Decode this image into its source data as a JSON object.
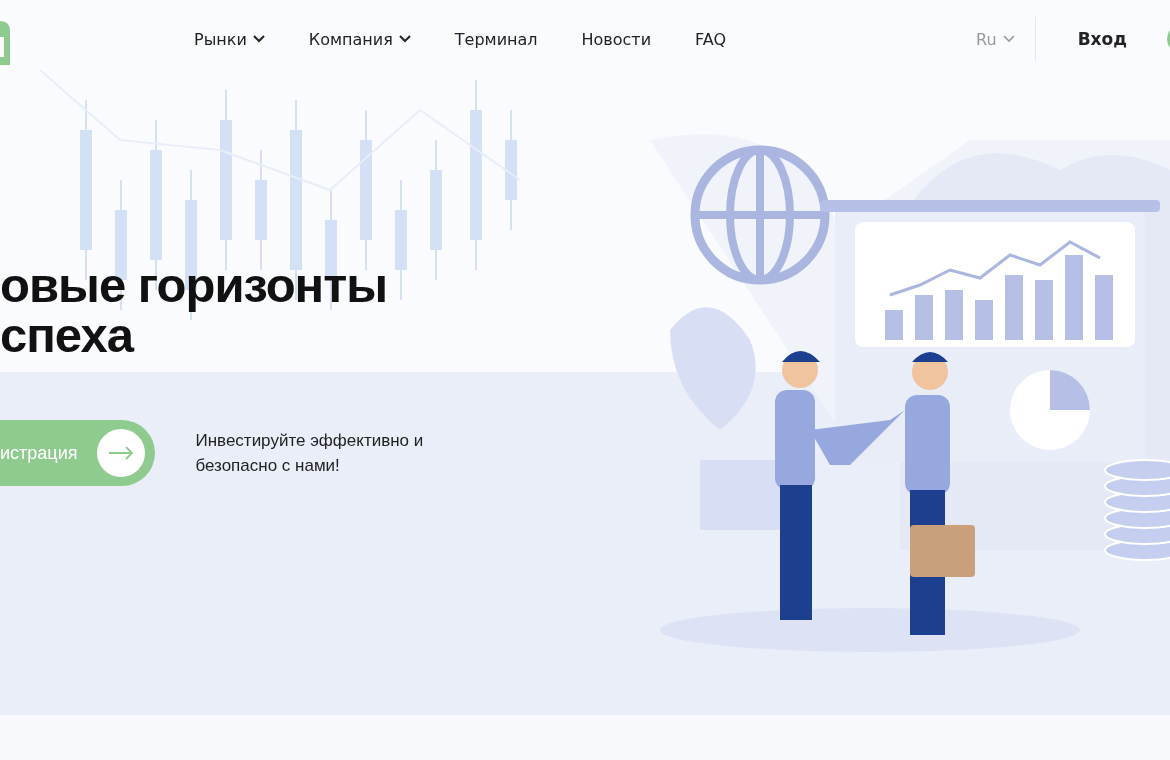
{
  "nav": {
    "items": [
      {
        "label": "Рынки",
        "has_dropdown": true
      },
      {
        "label": "Компания",
        "has_dropdown": true
      },
      {
        "label": "Терминал",
        "has_dropdown": false
      },
      {
        "label": "Новости",
        "has_dropdown": false
      },
      {
        "label": "FAQ",
        "has_dropdown": false
      }
    ],
    "language": "Ru",
    "login": "Вход"
  },
  "hero": {
    "title_lines": [
      "овые горизонты",
      "спеха"
    ],
    "cta": "истрация",
    "tagline": "Инвестируйте эффективно и безопасно с нами!"
  }
}
